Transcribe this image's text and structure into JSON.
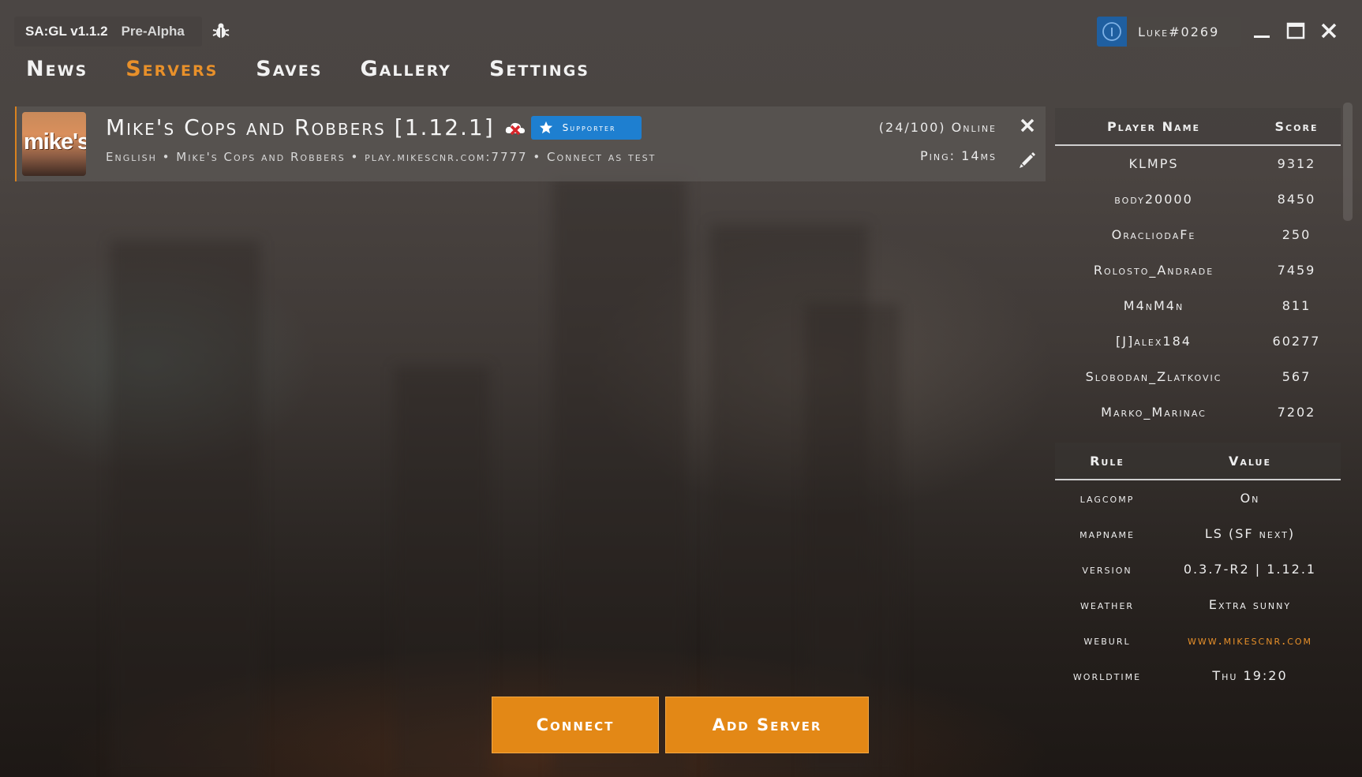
{
  "app": {
    "version": "SA:GL v1.1.2",
    "stage": "Pre-Alpha"
  },
  "user": {
    "name": "Luke#0269"
  },
  "nav": {
    "items": [
      "News",
      "Servers",
      "Saves",
      "Gallery",
      "Settings"
    ],
    "active": "Servers"
  },
  "server": {
    "thumb_text": "mike's",
    "name": "Mike's Cops and Robbers [1.12.1]",
    "badge": "Supporter",
    "language": "English",
    "mode": "Mike's Cops and Robbers",
    "address": "play.mikescnr.com:7777",
    "connect_as": "Connect as test",
    "online": "(24/100) Online",
    "ping": "Ping: 14ms"
  },
  "players": {
    "headers": [
      "Player Name",
      "Score"
    ],
    "rows": [
      {
        "name": "KLMPS",
        "score": "9312"
      },
      {
        "name": "body20000",
        "score": "8450"
      },
      {
        "name": "OracliodaFe",
        "score": "250"
      },
      {
        "name": "Rolosto_Andrade",
        "score": "7459"
      },
      {
        "name": "M4nM4n",
        "score": "811"
      },
      {
        "name": "[J]alex184",
        "score": "60277"
      },
      {
        "name": "Slobodan_Zlatkovic",
        "score": "567"
      },
      {
        "name": "Marko_Marinac",
        "score": "7202"
      }
    ]
  },
  "rules": {
    "headers": [
      "Rule",
      "Value"
    ],
    "rows": [
      {
        "rule": "lagcomp",
        "value": "On"
      },
      {
        "rule": "mapname",
        "value": "LS (SF next)"
      },
      {
        "rule": "version",
        "value": "0.3.7-R2 | 1.12.1"
      },
      {
        "rule": "weather",
        "value": "Extra sunny"
      },
      {
        "rule": "weburl",
        "value": "www.mikescnr.com"
      },
      {
        "rule": "worldtime",
        "value": "Thu 19:20"
      }
    ]
  },
  "actions": {
    "connect": "Connect",
    "add_server": "Add Server"
  },
  "colors": {
    "accent": "#e38816",
    "badge": "#1e7fd0",
    "link": "#e8902a"
  }
}
